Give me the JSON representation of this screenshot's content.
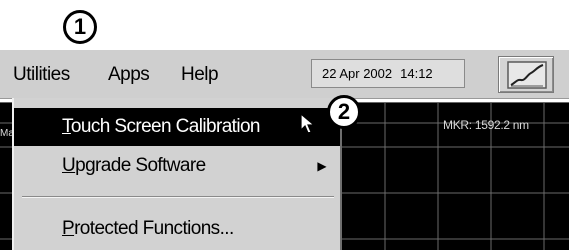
{
  "callouts": {
    "first": "1",
    "second": "2"
  },
  "menubar": {
    "menus": [
      {
        "label": "Utilities"
      },
      {
        "label": "Apps"
      },
      {
        "label": "Help"
      }
    ],
    "date": "22 Apr 2002",
    "time": "14:12"
  },
  "dropdown": {
    "items": [
      {
        "label_underlined": "T",
        "label_rest": "ouch Screen Calibration",
        "state": "highlighted"
      },
      {
        "label_underlined": "U",
        "label_rest": "pgrade Software",
        "has_submenu": true
      },
      {
        "label_underlined": "P",
        "label_rest": "rotected Functions..."
      }
    ]
  },
  "display": {
    "marker_readout": "MKR: 1592.2 nm",
    "left_label_fragment": "Ma"
  },
  "icons": {
    "toolbar_button": "graph-icon",
    "submenu": "chevron-right-icon",
    "pointer": "arrow-cursor-icon"
  },
  "colors": {
    "menubar": "#cfcfcf",
    "highlight": "#000000",
    "display_background": "#000000",
    "grid": "#6a6a6a"
  }
}
